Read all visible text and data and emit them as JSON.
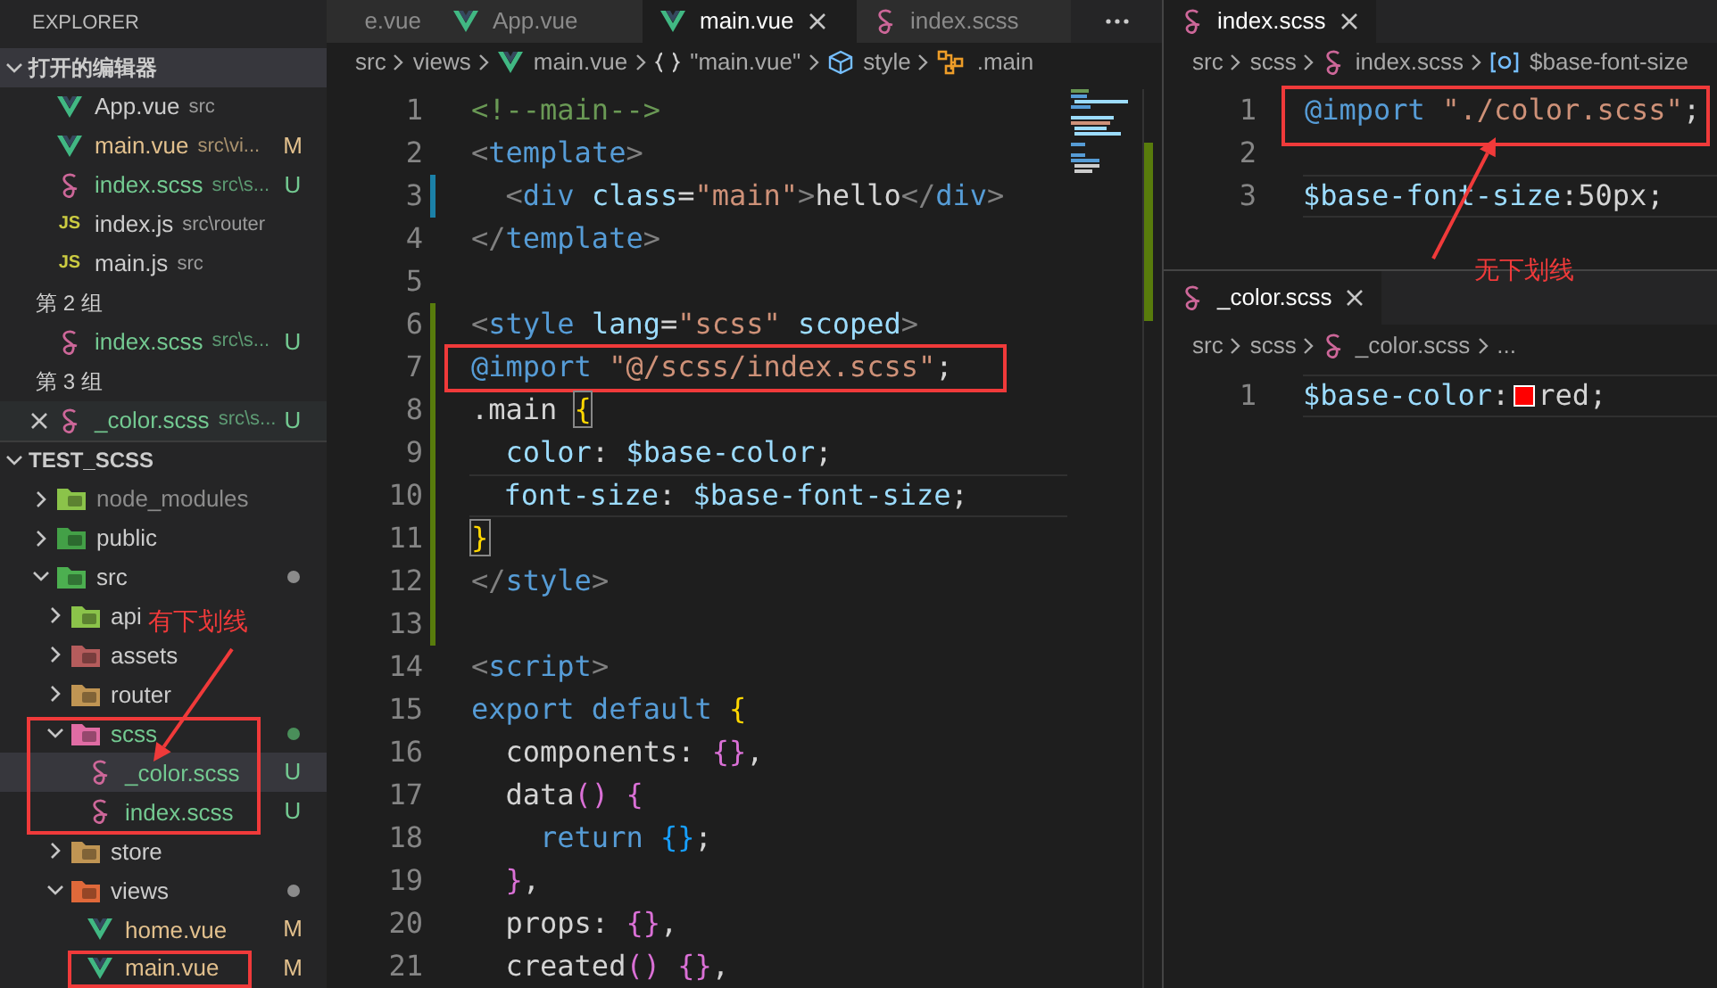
{
  "sidebar": {
    "title": "EXPLORER",
    "open_editors": {
      "title": "打开的编辑器",
      "expanded": true,
      "items": [
        {
          "kind": "vue",
          "name": "App.vue",
          "path": "src",
          "color": "#cccccc",
          "selected": false
        },
        {
          "kind": "vue",
          "name": "main.vue",
          "path": "src\\vi...",
          "status": "M",
          "color": "#e2c08d",
          "selected": false
        },
        {
          "kind": "scss",
          "name": "index.scss",
          "path": "src\\s...",
          "status": "U",
          "color": "#73c991",
          "selected": false
        },
        {
          "kind": "js",
          "badge": "JS",
          "name": "index.js",
          "path": "src\\router",
          "color": "#cccccc",
          "selected": false
        },
        {
          "kind": "js",
          "badge": "JS",
          "name": "main.js",
          "path": "src",
          "color": "#cccccc",
          "selected": false
        },
        {
          "kind": "group",
          "label": "第 2 组"
        },
        {
          "kind": "scss",
          "name": "index.scss",
          "path": "src\\s...",
          "status": "U",
          "color": "#73c991",
          "selected": false
        },
        {
          "kind": "group",
          "label": "第 3 组"
        },
        {
          "kind": "scss",
          "name": "_color.scss",
          "path": "src\\s...",
          "status": "U",
          "color": "#73c991",
          "selected": true
        }
      ]
    },
    "tree": {
      "title": "TEST_SCSS",
      "expanded": true,
      "children": [
        {
          "kind": "node-folder",
          "name": "node_modules",
          "color": "#8c8c8c",
          "expanded": false,
          "selected": false
        },
        {
          "kind": "public-folder",
          "name": "public",
          "color": "#cccccc",
          "expanded": false,
          "selected": false
        },
        {
          "kind": "src-folder",
          "name": "src",
          "color": "#cccccc",
          "dot": {
            "color": "#8b8b8b"
          },
          "expanded": true,
          "selected": false,
          "children": [
            {
              "kind": "api-folder",
              "name": "api",
              "color": "#cccccc",
              "expanded": false,
              "selected": false
            },
            {
              "kind": "assets-folder",
              "name": "assets",
              "color": "#cccccc",
              "expanded": false,
              "selected": false
            },
            {
              "kind": "folder",
              "name": "router",
              "color": "#cccccc",
              "expanded": false,
              "selected": false
            },
            {
              "kind": "scss-folder",
              "name": "scss",
              "color": "#73c991",
              "dot": {
                "color": "#4a8f5a"
              },
              "expanded": true,
              "selected": false,
              "children": [
                {
                  "kind": "scss",
                  "name": "_color.scss",
                  "status": "U",
                  "color": "#73c991",
                  "selected": true
                },
                {
                  "kind": "scss",
                  "name": "index.scss",
                  "status": "U",
                  "color": "#73c991",
                  "selected": false
                }
              ]
            },
            {
              "kind": "folder",
              "name": "store",
              "color": "#cccccc",
              "expanded": false,
              "selected": false
            },
            {
              "kind": "views-folder",
              "name": "views",
              "color": "#cccccc",
              "dot": {
                "color": "#8b8b8b"
              },
              "expanded": true,
              "selected": false,
              "children": [
                {
                  "kind": "vue",
                  "name": "home.vue",
                  "status": "M",
                  "color": "#e2c08d",
                  "selected": false
                },
                {
                  "kind": "vue",
                  "name": "main.vue",
                  "status": "M",
                  "color": "#e2c08d",
                  "selected": false
                }
              ]
            }
          ]
        }
      ]
    }
  },
  "editor": {
    "tabs": [
      {
        "kind": "text",
        "label": "e.vue",
        "selected": false
      },
      {
        "kind": "vue",
        "label": "App.vue",
        "selected": false
      },
      {
        "kind": "vue",
        "label": "main.vue",
        "selected": true
      },
      {
        "kind": "scss",
        "label": "index.scss",
        "selected": false
      }
    ],
    "breadcrumb": [
      {
        "kind": "text",
        "text": "src"
      },
      {
        "kind": "text",
        "text": "views"
      },
      {
        "kind": "vue",
        "text": "main.vue"
      },
      {
        "kind": "braces",
        "text": "\"main.vue\""
      },
      {
        "kind": "cube",
        "text": "style"
      },
      {
        "kind": "selector",
        "text": ".main"
      }
    ],
    "lines": [
      {
        "number": "1",
        "kind": "plain",
        "selected": false,
        "tokens": [
          {
            "kind": "c",
            "text": "<!--main-->"
          }
        ]
      },
      {
        "number": "2",
        "kind": "plain",
        "selected": false,
        "tokens": [
          {
            "kind": "p",
            "text": "<"
          },
          {
            "kind": "tag",
            "text": "template"
          },
          {
            "kind": "p",
            "text": ">"
          }
        ]
      },
      {
        "number": "3",
        "kind": "modified",
        "selected": false,
        "tokens": [
          {
            "kind": "p",
            "text": "  <"
          },
          {
            "kind": "tag",
            "text": "div"
          },
          {
            "kind": "attr",
            "text": " class"
          },
          {
            "kind": "txt",
            "text": "="
          },
          {
            "kind": "str",
            "text": "\"main\""
          },
          {
            "kind": "p",
            "text": ">"
          },
          {
            "kind": "txt",
            "text": "hello"
          },
          {
            "kind": "p",
            "text": "</"
          },
          {
            "kind": "tag",
            "text": "div"
          },
          {
            "kind": "p",
            "text": ">"
          }
        ]
      },
      {
        "number": "4",
        "kind": "plain",
        "selected": false,
        "tokens": [
          {
            "kind": "p",
            "text": "</"
          },
          {
            "kind": "tag",
            "text": "template"
          },
          {
            "kind": "p",
            "text": ">"
          }
        ]
      },
      {
        "number": "5",
        "kind": "plain",
        "selected": false
      },
      {
        "number": "6",
        "kind": "added",
        "selected": false,
        "tokens": [
          {
            "kind": "p",
            "text": "<"
          },
          {
            "kind": "tag",
            "text": "style"
          },
          {
            "kind": "attr",
            "text": " lang"
          },
          {
            "kind": "txt",
            "text": "="
          },
          {
            "kind": "str",
            "text": "\"scss\""
          },
          {
            "kind": "attr",
            "text": " scoped"
          },
          {
            "kind": "p",
            "text": ">"
          }
        ]
      },
      {
        "number": "7",
        "kind": "added",
        "selected": false,
        "tokens": [
          {
            "kind": "at",
            "text": "@import"
          },
          {
            "kind": "str",
            "text": " \"@/scss/index.scss\""
          },
          {
            "kind": "txt",
            "text": ";"
          }
        ]
      },
      {
        "number": "8",
        "kind": "added",
        "selected": false,
        "tokens": [
          {
            "kind": "sel",
            "text": ".main "
          },
          {
            "kind": "match",
            "text": "{"
          }
        ]
      },
      {
        "number": "9",
        "kind": "added",
        "selected": false,
        "tokens": [
          {
            "kind": "prop",
            "text": "  color"
          },
          {
            "kind": "txt",
            "text": ": "
          },
          {
            "kind": "var",
            "text": "$base-color"
          },
          {
            "kind": "txt",
            "text": ";"
          }
        ]
      },
      {
        "number": "10",
        "kind": "added",
        "selected": true,
        "tokens": [
          {
            "kind": "prop",
            "text": "  font-size"
          },
          {
            "kind": "txt",
            "text": ": "
          },
          {
            "kind": "var",
            "text": "$base-font-size"
          },
          {
            "kind": "txt",
            "text": ";"
          }
        ]
      },
      {
        "number": "11",
        "kind": "added",
        "selected": false,
        "tokens": [
          {
            "kind": "match",
            "text": "}"
          }
        ]
      },
      {
        "number": "12",
        "kind": "added",
        "selected": false,
        "tokens": [
          {
            "kind": "p",
            "text": "</"
          },
          {
            "kind": "tag",
            "text": "style"
          },
          {
            "kind": "p",
            "text": ">"
          }
        ]
      },
      {
        "number": "13",
        "kind": "added",
        "selected": false
      },
      {
        "number": "14",
        "kind": "plain",
        "selected": false,
        "tokens": [
          {
            "kind": "p",
            "text": "<"
          },
          {
            "kind": "tag",
            "text": "script"
          },
          {
            "kind": "p",
            "text": ">"
          }
        ]
      },
      {
        "number": "15",
        "kind": "plain",
        "selected": false,
        "tokens": [
          {
            "kind": "kw",
            "text": "export"
          },
          {
            "kind": "kw",
            "text": " default"
          },
          {
            "kind": "b1",
            "text": " {"
          }
        ]
      },
      {
        "number": "16",
        "kind": "plain",
        "selected": false,
        "tokens": [
          {
            "kind": "txt",
            "text": "  components: "
          },
          {
            "kind": "b2",
            "text": "{}"
          },
          {
            "kind": "txt",
            "text": ","
          }
        ]
      },
      {
        "number": "17",
        "kind": "plain",
        "selected": false,
        "tokens": [
          {
            "kind": "txt",
            "text": "  data"
          },
          {
            "kind": "b2",
            "text": "() {"
          }
        ]
      },
      {
        "number": "18",
        "kind": "plain",
        "selected": false,
        "tokens": [
          {
            "kind": "kw",
            "text": "    return"
          },
          {
            "kind": "b3",
            "text": " {}"
          },
          {
            "kind": "txt",
            "text": ";"
          }
        ]
      },
      {
        "number": "19",
        "kind": "plain",
        "selected": false,
        "tokens": [
          {
            "kind": "b2",
            "text": "  }"
          },
          {
            "kind": "txt",
            "text": ","
          }
        ]
      },
      {
        "number": "20",
        "kind": "plain",
        "selected": false,
        "tokens": [
          {
            "kind": "txt",
            "text": "  props: "
          },
          {
            "kind": "b2",
            "text": "{}"
          },
          {
            "kind": "txt",
            "text": ","
          }
        ]
      },
      {
        "number": "21",
        "kind": "plain",
        "selected": false,
        "tokens": [
          {
            "kind": "txt",
            "text": "  created"
          },
          {
            "kind": "b2",
            "text": "() {}"
          },
          {
            "kind": "txt",
            "text": ","
          }
        ]
      }
    ]
  },
  "right_top": {
    "tabs": [
      {
        "kind": "scss",
        "label": "index.scss",
        "selected": true
      }
    ],
    "breadcrumb": [
      {
        "kind": "text",
        "text": "src"
      },
      {
        "kind": "text",
        "text": "scss"
      },
      {
        "kind": "scss",
        "text": "index.scss"
      },
      {
        "kind": "variable",
        "text": "$base-font-size"
      }
    ],
    "lines": [
      {
        "number": "1",
        "selected": false,
        "tokens": [
          {
            "kind": "at",
            "text": "@import"
          },
          {
            "kind": "str",
            "text": " \"./color.scss\""
          },
          {
            "kind": "txt",
            "text": ";"
          }
        ]
      },
      {
        "number": "2",
        "selected": false
      },
      {
        "number": "3",
        "selected": true,
        "tokens": [
          {
            "kind": "var",
            "text": "$base-font-size"
          },
          {
            "kind": "txt",
            "text": ":50px;"
          }
        ]
      }
    ]
  },
  "right_bottom": {
    "tabs": [
      {
        "kind": "scss",
        "label": "_color.scss",
        "selected": true
      }
    ],
    "breadcrumb": [
      {
        "kind": "text",
        "text": "src"
      },
      {
        "kind": "text",
        "text": "scss"
      },
      {
        "kind": "scss",
        "text": "_color.scss"
      },
      {
        "kind": "text",
        "text": "..."
      }
    ],
    "lines": [
      {
        "number": "1",
        "selected": true,
        "tokens": [
          {
            "kind": "var",
            "text": "$base-color"
          },
          {
            "kind": "txt",
            "text": ":"
          },
          {
            "kind": "swatch",
            "color": "#ff0000"
          },
          {
            "kind": "txt",
            "text": "red;"
          }
        ]
      }
    ]
  },
  "annotations": [
    {
      "kind": "box"
    },
    {
      "kind": "box"
    },
    {
      "kind": "box"
    },
    {
      "kind": "box"
    },
    {
      "kind": "label",
      "text": "有下划线"
    },
    {
      "kind": "arrow"
    },
    {
      "kind": "label",
      "text": "无下划线"
    },
    {
      "kind": "arrow"
    }
  ]
}
